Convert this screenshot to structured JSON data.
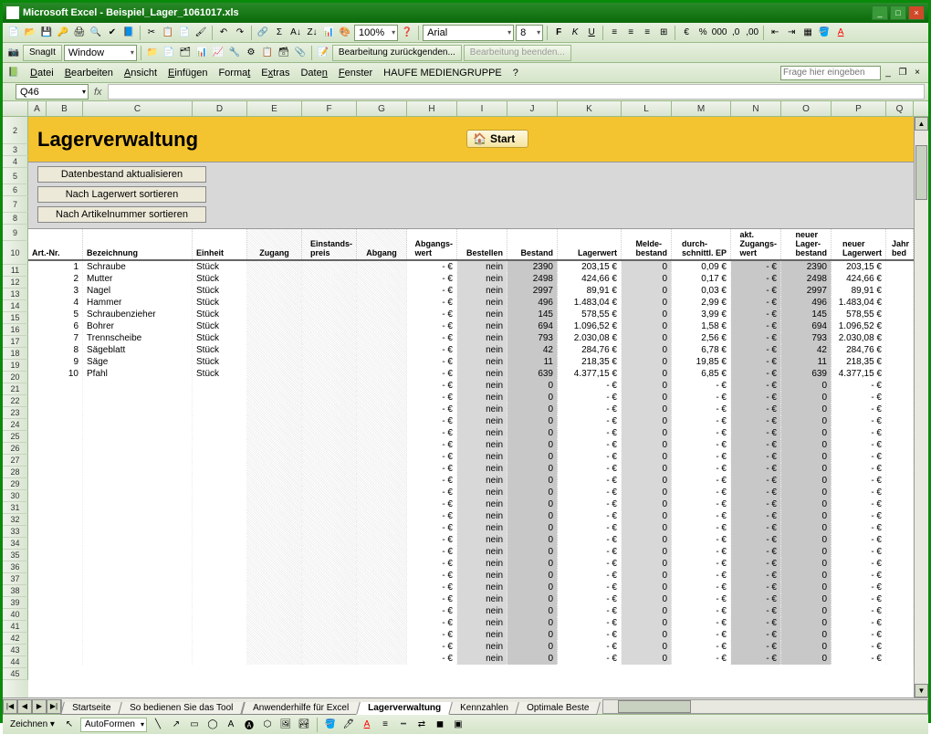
{
  "app": {
    "name": "Microsoft Excel",
    "file": "Beispiel_Lager_1061017.xls"
  },
  "window_buttons": {
    "min": "_",
    "max": "□",
    "close": "×"
  },
  "toolbar1": {
    "snagit_label": "SnagIt",
    "window_label": "Window",
    "zoom": "100%",
    "track_changes": "Bearbeitung zurückgenden...",
    "end_review": "Bearbeitung beenden..."
  },
  "toolbar2": {
    "font_name": "Arial",
    "font_size": "8"
  },
  "menu": {
    "datei": "Datei",
    "bearbeiten": "Bearbeiten",
    "ansicht": "Ansicht",
    "einfuegen": "Einfügen",
    "format": "Format",
    "extras": "Extras",
    "daten": "Daten",
    "fenster": "Fenster",
    "haufe": "HAUFE MEDIENGRUPPE",
    "help": "?"
  },
  "help_placeholder": "Frage hier eingeben",
  "namebox": "Q46",
  "columns": [
    "A",
    "B",
    "C",
    "D",
    "E",
    "F",
    "G",
    "H",
    "I",
    "J",
    "K",
    "L",
    "M",
    "N",
    "O",
    "P",
    "Q"
  ],
  "row_start": 2,
  "row_end": 45,
  "banner_title": "Lagerverwaltung",
  "start_btn": "Start",
  "buttons": {
    "refresh": "Datenbestand aktualisieren",
    "sort_value": "Nach Lagerwert sortieren",
    "sort_art": "Nach Artikelnummer sortieren"
  },
  "headers": {
    "art": "Art.-Nr.",
    "bez": "Bezeichnung",
    "ein": "Einheit",
    "zug": "Zugang",
    "ep": "Einstands-\npreis",
    "abg": "Abgang",
    "abgw": "Abgangs-\nwert",
    "best": "Bestellen",
    "bstd": "Bestand",
    "lw": "Lagerwert",
    "mb": "Melde-\nbestand",
    "dep": "durch-\nschnittl. EP",
    "azw": "akt.\nZugangs-\nwert",
    "nlb": "neuer\nLager-\nbestand",
    "nlw": "neuer\nLagerwert",
    "jb": "Jahr\nbed"
  },
  "items": [
    {
      "nr": "1",
      "bez": "Schraube",
      "ein": "Stück",
      "bstd": "2390",
      "lw": "203,15 €",
      "dep": "0,09 €",
      "nlb": "2390",
      "nlw": "203,15 €"
    },
    {
      "nr": "2",
      "bez": "Mutter",
      "ein": "Stück",
      "bstd": "2498",
      "lw": "424,66 €",
      "dep": "0,17 €",
      "nlb": "2498",
      "nlw": "424,66 €"
    },
    {
      "nr": "3",
      "bez": "Nagel",
      "ein": "Stück",
      "bstd": "2997",
      "lw": "89,91 €",
      "dep": "0,03 €",
      "nlb": "2997",
      "nlw": "89,91 €"
    },
    {
      "nr": "4",
      "bez": "Hammer",
      "ein": "Stück",
      "bstd": "496",
      "lw": "1.483,04 €",
      "dep": "2,99 €",
      "nlb": "496",
      "nlw": "1.483,04 €"
    },
    {
      "nr": "5",
      "bez": "Schraubenzieher",
      "ein": "Stück",
      "bstd": "145",
      "lw": "578,55 €",
      "dep": "3,99 €",
      "nlb": "145",
      "nlw": "578,55 €"
    },
    {
      "nr": "6",
      "bez": "Bohrer",
      "ein": "Stück",
      "bstd": "694",
      "lw": "1.096,52 €",
      "dep": "1,58 €",
      "nlb": "694",
      "nlw": "1.096,52 €"
    },
    {
      "nr": "7",
      "bez": "Trennscheibe",
      "ein": "Stück",
      "bstd": "793",
      "lw": "2.030,08 €",
      "dep": "2,56 €",
      "nlb": "793",
      "nlw": "2.030,08 €"
    },
    {
      "nr": "8",
      "bez": "Sägeblatt",
      "ein": "Stück",
      "bstd": "42",
      "lw": "284,76 €",
      "dep": "6,78 €",
      "nlb": "42",
      "nlw": "284,76 €"
    },
    {
      "nr": "9",
      "bez": "Säge",
      "ein": "Stück",
      "bstd": "11",
      "lw": "218,35 €",
      "dep": "19,85 €",
      "nlb": "11",
      "nlw": "218,35 €"
    },
    {
      "nr": "10",
      "bez": "Pfahl",
      "ein": "Stück",
      "bstd": "639",
      "lw": "4.377,15 €",
      "dep": "6,85 €",
      "nlb": "639",
      "nlw": "4.377,15 €"
    }
  ],
  "empty_rows": 24,
  "txt": {
    "dash": "-",
    "euro": "€",
    "dash_euro": "-   €",
    "nein": "nein",
    "zero": "0"
  },
  "tabs": {
    "list": [
      "Startseite",
      "So bedienen Sie das Tool",
      "Anwenderhilfe für Excel",
      "Lagerverwaltung",
      "Kennzahlen",
      "Optimale Beste"
    ],
    "active": 3
  },
  "statusbar": {
    "zeichnen": "Zeichnen",
    "autoformen": "AutoFormen"
  }
}
